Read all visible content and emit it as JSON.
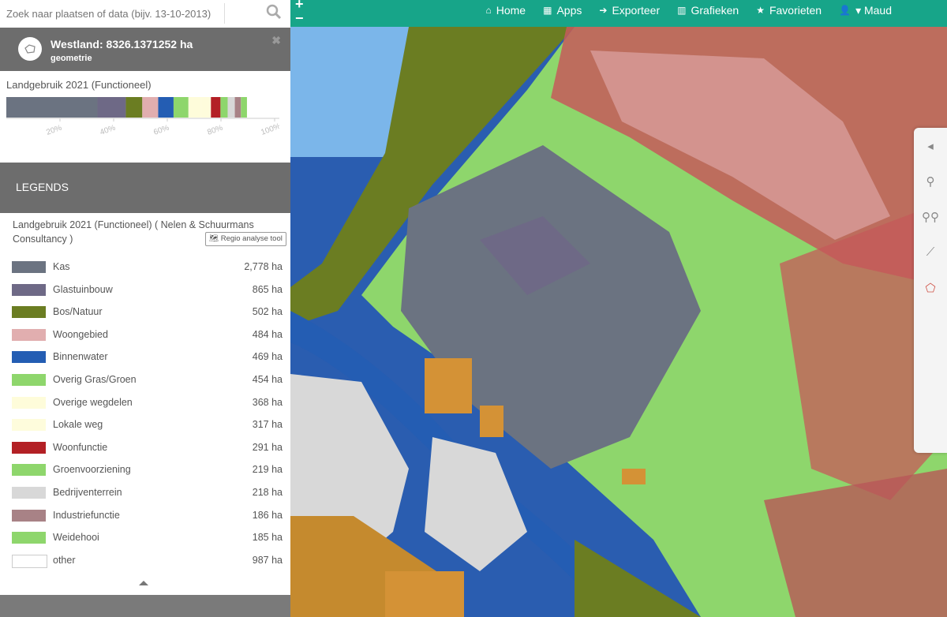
{
  "search": {
    "placeholder": "Zoek naar plaatsen of data (bijv. 13-10-2013)"
  },
  "nav": [
    {
      "label": "Home",
      "icon": "⌂"
    },
    {
      "label": "Apps",
      "icon": "▦"
    },
    {
      "label": "Exporteer",
      "icon": "➔"
    },
    {
      "label": "Grafieken",
      "icon": "▥"
    },
    {
      "label": "Favorieten",
      "icon": "★"
    },
    {
      "label": "▾ Maud",
      "icon": "👤"
    }
  ],
  "zoom": {
    "plus": "+",
    "minus": "−"
  },
  "geometry": {
    "title": "Westland: 8326.1371252 ha",
    "subtitle": "geometrie"
  },
  "chart_data": {
    "type": "bar",
    "title": "Landgebruik 2021 (Functioneel)",
    "stacked_horizontal": true,
    "xlim": [
      0,
      100
    ],
    "ticks": [
      "20%",
      "40%",
      "60%",
      "80%",
      "100%"
    ],
    "segments": [
      {
        "name": "Kas",
        "value": 2778,
        "color": "#6b7381"
      },
      {
        "name": "Glastuinbouw",
        "value": 865,
        "color": "#6e6986"
      },
      {
        "name": "Bos/Natuur",
        "value": 502,
        "color": "#6b7d22"
      },
      {
        "name": "Woongebied",
        "value": 484,
        "color": "#e1aeaf"
      },
      {
        "name": "Binnenwater",
        "value": 469,
        "color": "#245db3"
      },
      {
        "name": "Overig Gras/Groen",
        "value": 454,
        "color": "#8ed66c"
      },
      {
        "name": "Overige wegdelen",
        "value": 368,
        "color": "#fefcda"
      },
      {
        "name": "Lokale weg",
        "value": 317,
        "color": "#fefcdc"
      },
      {
        "name": "Woonfunctie",
        "value": 291,
        "color": "#b32025"
      },
      {
        "name": "Groenvoorziening",
        "value": 219,
        "color": "#8ed66c"
      },
      {
        "name": "Bedrijventerrein",
        "value": 218,
        "color": "#d8d8d8"
      },
      {
        "name": "Industriefunctie",
        "value": 186,
        "color": "#a88286"
      },
      {
        "name": "Weidehooi",
        "value": 185,
        "color": "#8ed66c"
      },
      {
        "name": "other",
        "value": 987,
        "color": "#ffffff"
      }
    ]
  },
  "legend": {
    "header": "LEGENDS",
    "source": "Landgebruik 2021 (Functioneel) ( Nelen & Schuurmans Consultancy )",
    "tool_button": "Regio analyse tool",
    "items": [
      {
        "name": "Kas",
        "value": "2,778 ha",
        "color": "#6b7381"
      },
      {
        "name": "Glastuinbouw",
        "value": "865 ha",
        "color": "#6e6986"
      },
      {
        "name": "Bos/Natuur",
        "value": "502 ha",
        "color": "#6b7d22"
      },
      {
        "name": "Woongebied",
        "value": "484 ha",
        "color": "#e1aeaf"
      },
      {
        "name": "Binnenwater",
        "value": "469 ha",
        "color": "#245db3"
      },
      {
        "name": "Overig Gras/Groen",
        "value": "454 ha",
        "color": "#8ed66c"
      },
      {
        "name": "Overige wegdelen",
        "value": "368 ha",
        "color": "#fefcda"
      },
      {
        "name": "Lokale weg",
        "value": "317 ha",
        "color": "#fefcdc"
      },
      {
        "name": "Woonfunctie",
        "value": "291 ha",
        "color": "#b32025"
      },
      {
        "name": "Groenvoorziening",
        "value": "219 ha",
        "color": "#8ed66c"
      },
      {
        "name": "Bedrijventerrein",
        "value": "218 ha",
        "color": "#d8d8d8"
      },
      {
        "name": "Industriefunctie",
        "value": "186 ha",
        "color": "#a88286"
      },
      {
        "name": "Weidehooi",
        "value": "185 ha",
        "color": "#8ed66c"
      },
      {
        "name": "other",
        "value": "987 ha",
        "color": "#ffffff"
      }
    ]
  },
  "map_tools": [
    {
      "icon": "collapse-left-icon",
      "glyph": "◂"
    },
    {
      "icon": "marker-icon",
      "glyph": "⚲"
    },
    {
      "icon": "multi-marker-icon",
      "glyph": "⚲⚲"
    },
    {
      "icon": "line-icon",
      "glyph": "⟋"
    },
    {
      "icon": "polygon-icon",
      "glyph": "⬠"
    }
  ]
}
